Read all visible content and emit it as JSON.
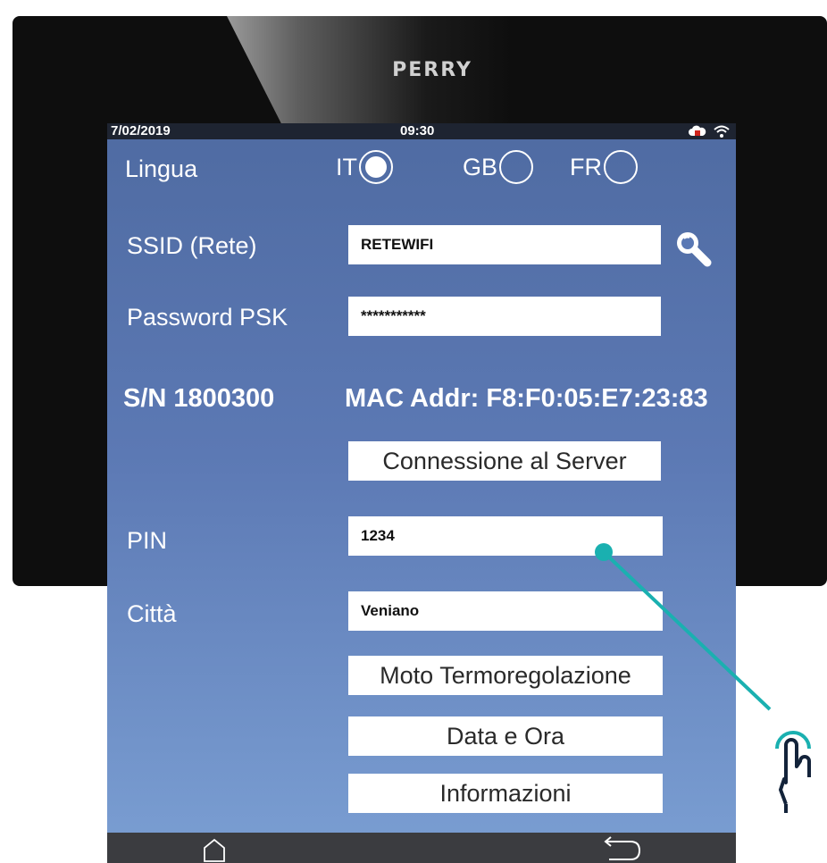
{
  "device": {
    "brand": "PERRY"
  },
  "status": {
    "date": "7/02/2019",
    "time": "09:30",
    "cloud_icon": "cloud-icon",
    "wifi_icon": "wifi-icon"
  },
  "language": {
    "label": "Lingua",
    "options": [
      {
        "code": "IT",
        "selected": true
      },
      {
        "code": "GB",
        "selected": false
      },
      {
        "code": "FR",
        "selected": false
      }
    ]
  },
  "ssid": {
    "label": "SSID (Rete)",
    "value": "RETEWIFI"
  },
  "password": {
    "label": "Password PSK",
    "value": "***********"
  },
  "serial": {
    "label": "S/N 1800300"
  },
  "mac": {
    "label": "MAC Addr: F8:F0:05:E7:23:83"
  },
  "buttons": {
    "server": "Connessione al Server",
    "thermo": "Moto Termoregolazione",
    "datetime": "Data e Ora",
    "info": "Informazioni"
  },
  "pin": {
    "label": "PIN",
    "value": "1234"
  },
  "city": {
    "label": "Città",
    "value": "Veniano"
  },
  "colors": {
    "screen_top": "#4f6ba2",
    "screen_bottom": "#7b9fd3",
    "pointer": "#1ab0b0",
    "hand": "#13233a"
  }
}
